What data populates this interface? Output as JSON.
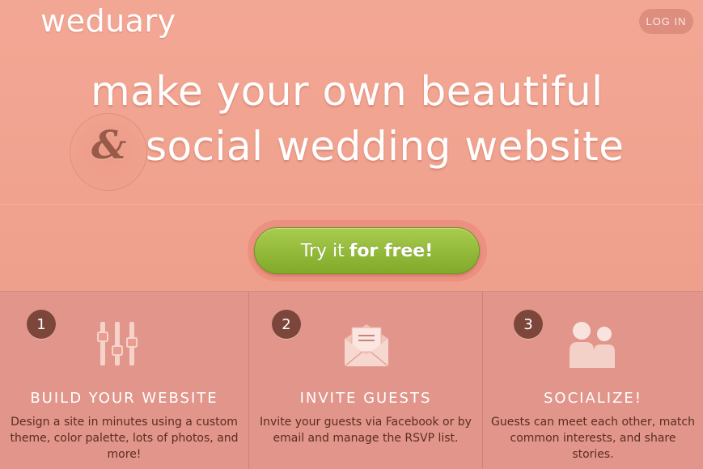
{
  "header": {
    "logo": "weduary",
    "login_label": "LOG IN"
  },
  "hero": {
    "line1": "make your own beautiful",
    "ampersand": "&",
    "line2": "social wedding website",
    "cta_light": "Try it",
    "cta_strong": "for free!"
  },
  "features": [
    {
      "number": "1",
      "icon": "sliders-icon",
      "title": "BUILD YOUR WEBSITE",
      "description": "Design a site in minutes using a custom theme, color palette, lots of photos, and more!"
    },
    {
      "number": "2",
      "icon": "envelope-icon",
      "title": "INVITE GUESTS",
      "description": "Invite your guests via Facebook or by email and manage the RSVP list."
    },
    {
      "number": "3",
      "icon": "people-icon",
      "title": "SOCIALIZE!",
      "description": "Guests can meet each other, match common interests, and share stories."
    }
  ],
  "colors": {
    "background": "#f0a08e",
    "cta_green": "#94bb3c",
    "badge_brown": "#7d463b"
  }
}
